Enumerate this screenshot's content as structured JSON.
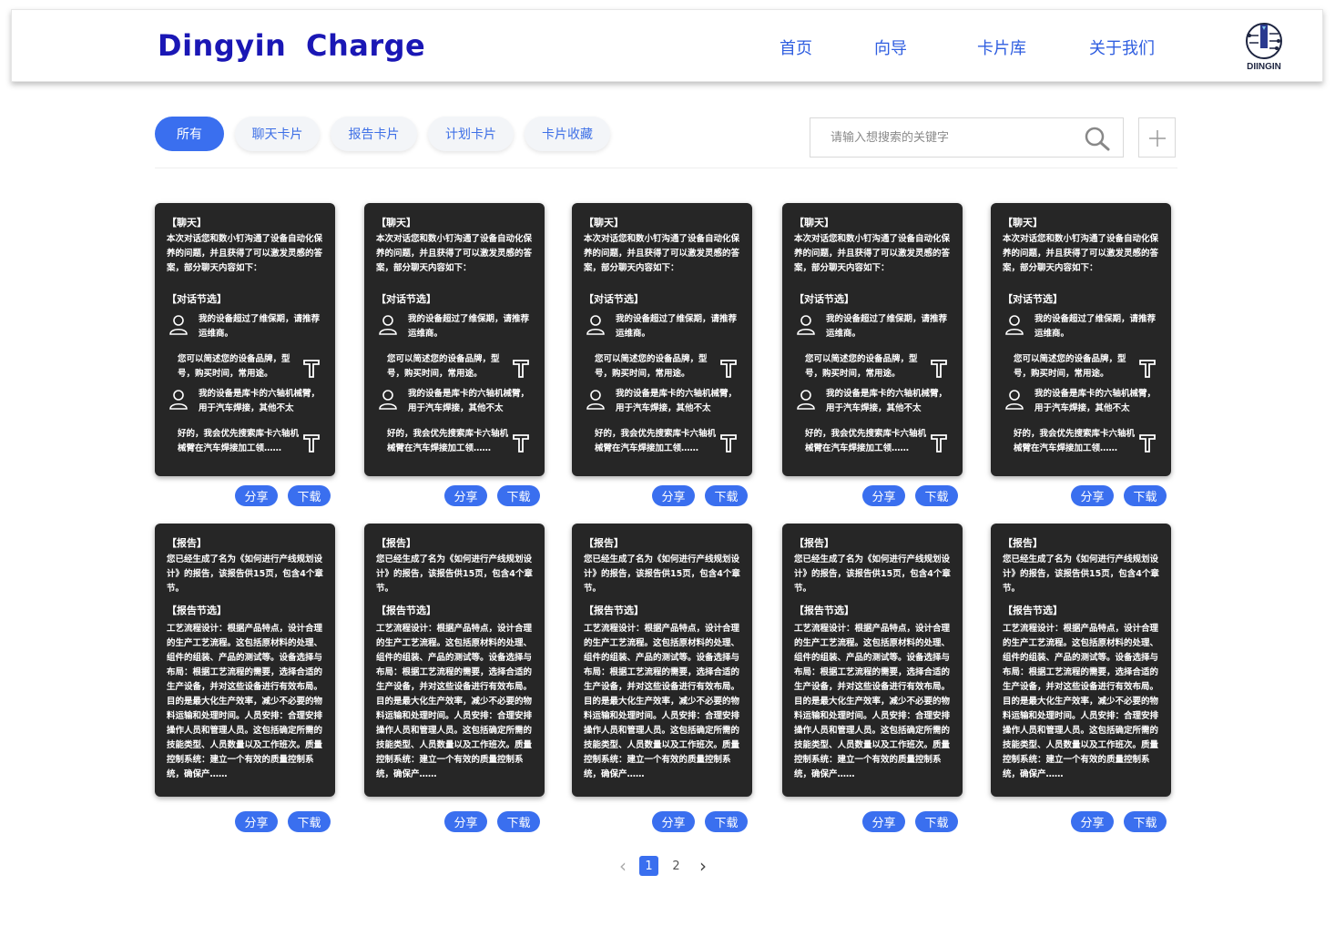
{
  "header": {
    "brand": "Dingyin  Charge",
    "nav": [
      "首页",
      "向导",
      "卡片库",
      "关于我们"
    ],
    "logo_text": "DIINGIN"
  },
  "filters": {
    "chips": [
      "所有",
      "聊天卡片",
      "报告卡片",
      "计划卡片",
      "卡片收藏"
    ],
    "active_index": 0
  },
  "search": {
    "placeholder": "请输入想搜索的关键字"
  },
  "chat_card": {
    "tag": "【聊天】",
    "intro": "本次对话您和数小钉沟通了设备自动化保养的问题，并且获得了可以激发灵感的答案，部分聊天内容如下：",
    "section": "【对话节选】",
    "messages": [
      {
        "role": "user",
        "icon": "user-icon",
        "text": "我的设备超过了维保期，请推荐运维商。"
      },
      {
        "role": "bot",
        "icon": "bot-icon",
        "text": "您可以简述您的设备品牌，型号，购买时间，常用途。"
      },
      {
        "role": "user",
        "icon": "user-icon",
        "text": "我的设备是库卡的六轴机械臂，用于汽车焊接，其他不太"
      },
      {
        "role": "bot",
        "icon": "bot-icon",
        "text": "好的，我会优先搜索库卡六轴机械臂在汽车焊接加工领……"
      }
    ]
  },
  "report_card": {
    "tag": "【报告】",
    "intro": "您已经生成了名为《如何进行产线规划设计》的报告，该报告供15页，包含4个章节。",
    "section": "【报告节选】",
    "body": "工艺流程设计：根据产品特点，设计合理的生产工艺流程。这包括原材料的处理、组件的组装、产品的测试等。设备选择与布局：根据工艺流程的需要，选择合适的生产设备，并对这些设备进行有效布局。目的是最大化生产效率，减少不必要的物料运输和处理时间。人员安排：合理安排操作人员和管理人员。这包括确定所需的技能类型、人员数量以及工作班次。质量控制系统：建立一个有效的质量控制系统，确保产……"
  },
  "card_actions": {
    "share": "分享",
    "download": "下载"
  },
  "pagination": {
    "prev": "‹",
    "pages": [
      "1",
      "2"
    ],
    "current": "1",
    "next": "›"
  },
  "colors": {
    "accent": "#3a6fef",
    "brand": "#1a17b5",
    "card_bg": "#262626",
    "nav": "#2f5ee0"
  }
}
